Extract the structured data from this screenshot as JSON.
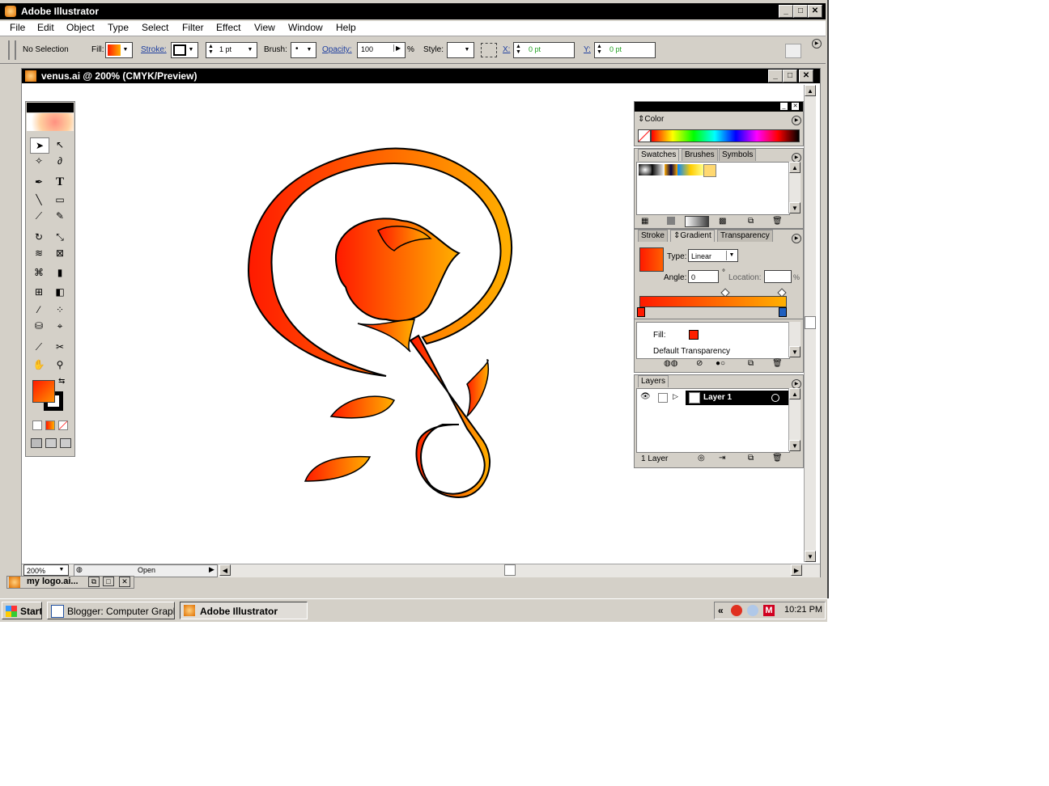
{
  "app": {
    "title": "Adobe Illustrator"
  },
  "menu": [
    "File",
    "Edit",
    "Object",
    "Type",
    "Select",
    "Filter",
    "Effect",
    "View",
    "Window",
    "Help"
  ],
  "control_bar": {
    "selection": "No Selection",
    "fill_label": "Fill:",
    "stroke_label": "Stroke:",
    "stroke_weight": "1 pt",
    "brush_label": "Brush:",
    "brush_value": "•",
    "opacity_label": "Opacity:",
    "opacity_value": "100",
    "percent": "%",
    "style_label": "Style:",
    "x_label": "X:",
    "x_value": "0 pt",
    "y_label": "Y:",
    "y_value": "0 pt"
  },
  "document": {
    "title": "venus.ai @ 200% (CMYK/Preview)",
    "zoom": "200%",
    "status": "Open"
  },
  "minimized_doc": "my logo.ai...",
  "color_panel": {
    "tab": "Color"
  },
  "swatches_panel": {
    "tabs": [
      "Swatches",
      "Brushes",
      "Symbols"
    ]
  },
  "gradient_panel": {
    "tabs": [
      "Stroke",
      "Gradient",
      "Transparency"
    ],
    "type_label": "Type:",
    "type_value": "Linear",
    "angle_label": "Angle:",
    "angle_value": "0",
    "degree": "°",
    "location_label": "Location:",
    "location_unit": "%",
    "fill_label": "Fill:",
    "default_transparency": "Default Transparency"
  },
  "layers_panel": {
    "tab": "Layers",
    "layer_name": "Layer 1",
    "footer": "1 Layer"
  },
  "taskbar": {
    "start": "Start",
    "items": [
      "Blogger: Computer Graphi...",
      "Adobe Illustrator"
    ],
    "chevron": "«",
    "clock": "10:21 PM"
  },
  "colors": {
    "gradient_start": "#ff1a00",
    "gradient_end": "#ffb000",
    "title_bg": "#000000",
    "chrome": "#d4d0c8"
  }
}
